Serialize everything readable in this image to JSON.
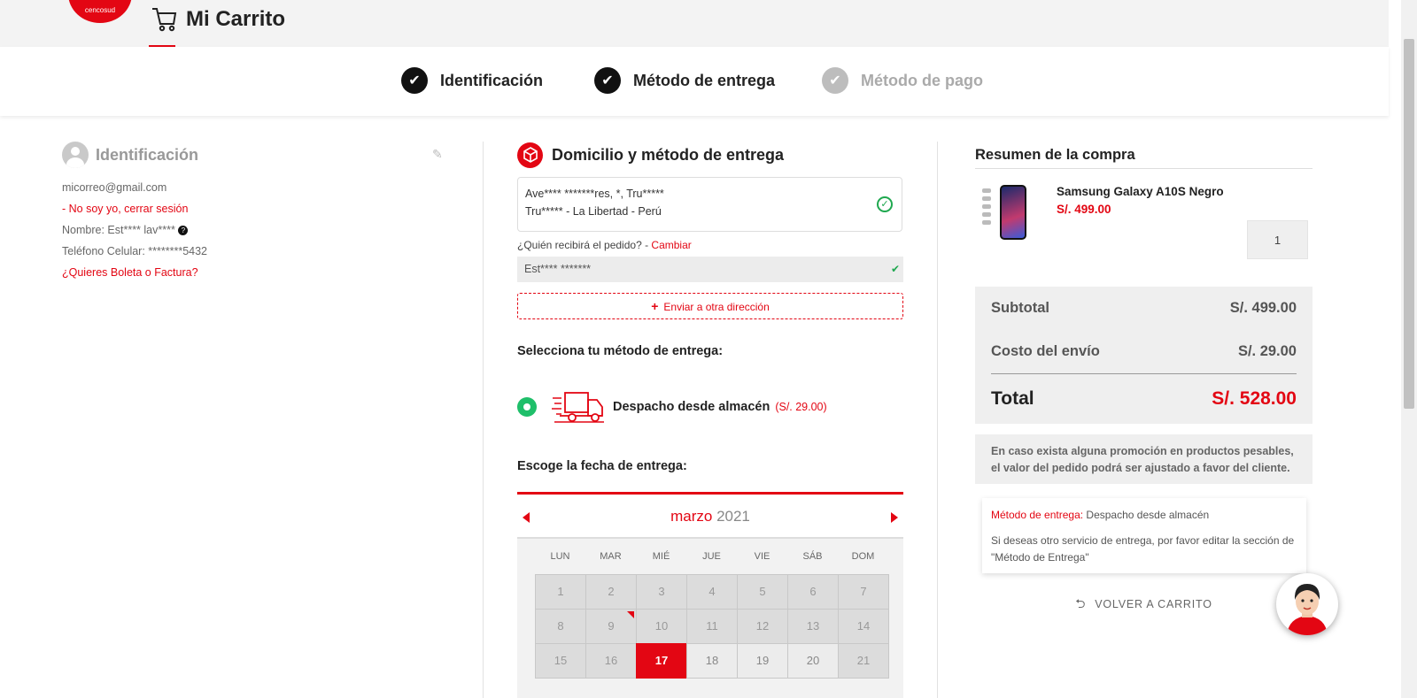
{
  "brand": {
    "logo_text": "cencosud",
    "accent": "#e30613"
  },
  "header": {
    "title": "Mi Carrito"
  },
  "steps": [
    {
      "label": "Identificación",
      "state": "done"
    },
    {
      "label": "Método de entrega",
      "state": "done"
    },
    {
      "label": "Método de pago",
      "state": "pending"
    }
  ],
  "identification": {
    "title": "Identificación",
    "email": "micorreo@gmail.com",
    "not_me": "- No soy yo, cerrar sesión",
    "name": "Nombre: Est**** lav****",
    "phone": "Teléfono Celular:  ********5432",
    "invoice_link": "¿Quieres Boleta o Factura?"
  },
  "delivery": {
    "title": "Domicilio y método de entrega",
    "address_line1": "Ave**** *******res, *, Tru*****",
    "address_line2": "Tru***** - La Libertad - Perú",
    "who_receives": "¿Quién recibirá el pedido? -",
    "change": "Cambiar",
    "receiver": "Est****  *******",
    "other_address": "Enviar a otra dirección",
    "method_label": "Selecciona tu método de entrega:",
    "method_name": "Despacho desde almacén",
    "method_price": "(S/. 29.00)",
    "date_label": "Escoge la fecha de entrega:"
  },
  "calendar": {
    "month": "marzo",
    "year": "2021",
    "dows": [
      "LUN",
      "MAR",
      "MIÉ",
      "JUE",
      "VIE",
      "SÁB",
      "DOM"
    ],
    "days": [
      [
        "1",
        "2",
        "3",
        "4",
        "5",
        "6",
        "7"
      ],
      [
        "8",
        "9",
        "10",
        "11",
        "12",
        "13",
        "14"
      ],
      [
        "15",
        "16",
        "17",
        "18",
        "19",
        "20",
        "21"
      ]
    ],
    "selected": "17"
  },
  "summary": {
    "title": "Resumen de la compra",
    "product_name": "Samsung Galaxy A10S Negro",
    "product_price": "S/. 499.00",
    "quantity": "1",
    "subtotal_label": "Subtotal",
    "subtotal": "S/. 499.00",
    "shipping_label": "Costo del envío",
    "shipping": "S/. 29.00",
    "total_label": "Total",
    "total": "S/. 528.00",
    "note": "En caso exista alguna promoción en productos pesables, el valor del pedido podrá ser ajustado a favor del cliente.",
    "method_label": "Método de entrega:",
    "method_value": "Despacho desde almacén",
    "edit_note": "Si deseas otro servicio de entrega, por favor editar la sección de \"Método de Entrega\"",
    "back": "VOLVER A CARRITO"
  }
}
